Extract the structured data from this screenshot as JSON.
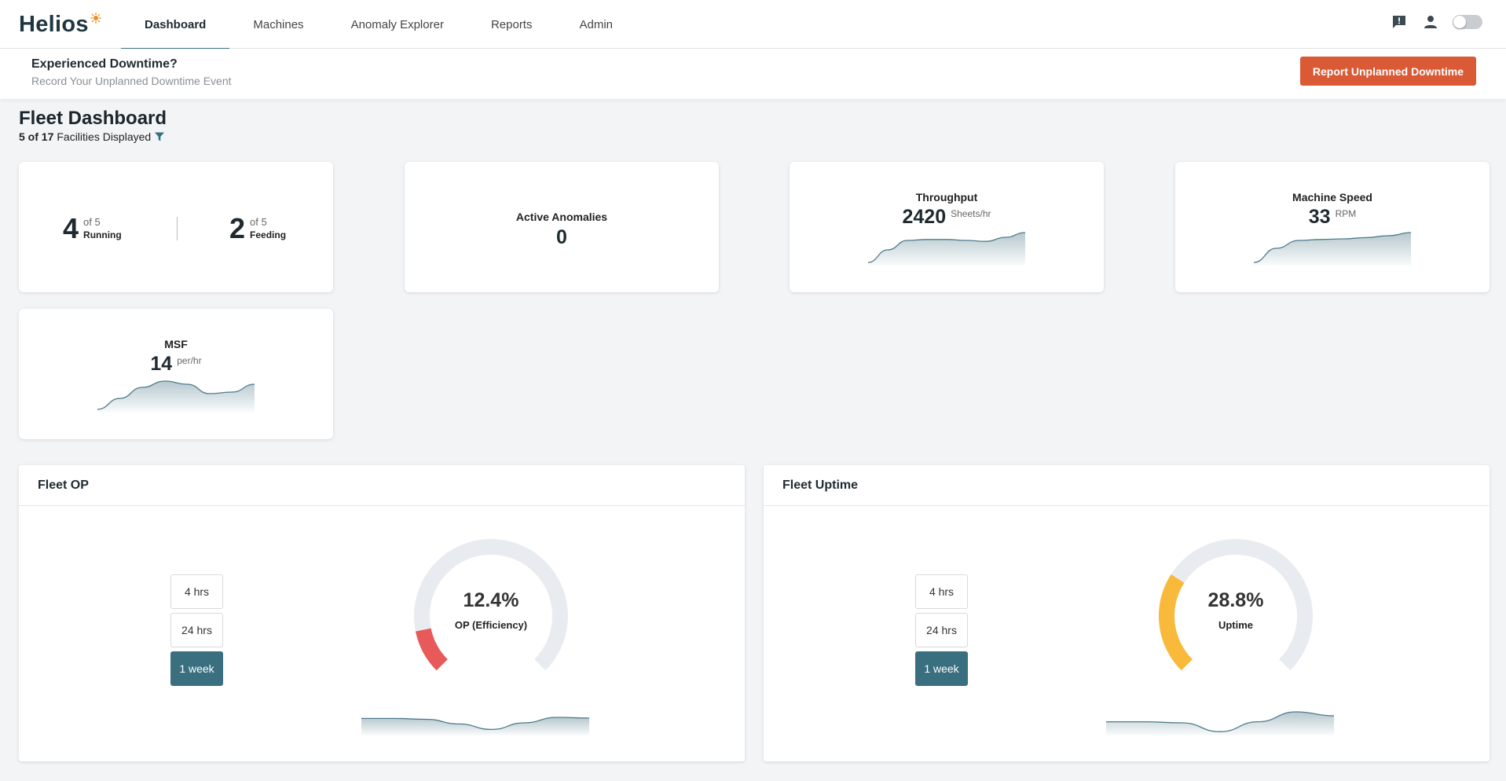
{
  "app": {
    "name": "Helios"
  },
  "nav": {
    "items": [
      {
        "label": "Dashboard"
      },
      {
        "label": "Machines"
      },
      {
        "label": "Anomaly Explorer"
      },
      {
        "label": "Reports"
      },
      {
        "label": "Admin"
      }
    ],
    "active_index": 0
  },
  "header_icons": [
    "feedback-icon",
    "user-icon",
    "theme-toggle"
  ],
  "banner": {
    "title": "Experienced Downtime?",
    "subtitle": "Record Your Unplanned Downtime Event",
    "button_label": "Report Unplanned Downtime"
  },
  "dashboard": {
    "title": "Fleet Dashboard",
    "facilities_count": "5 of 17",
    "facilities_text": "Facilities Displayed"
  },
  "status_card": {
    "running": {
      "value": "4",
      "of": "of 5",
      "label": "Running"
    },
    "feeding": {
      "value": "2",
      "of": "of 5",
      "label": "Feeding"
    }
  },
  "anomalies_card": {
    "label": "Active Anomalies",
    "value": "0"
  },
  "throughput_card": {
    "label": "Throughput",
    "value": "2420",
    "unit": "Sheets/hr",
    "spark": [
      0.05,
      0.45,
      0.75,
      0.78,
      0.78,
      0.75,
      0.72,
      0.85,
      1.0
    ]
  },
  "speed_card": {
    "label": "Machine Speed",
    "value": "33",
    "unit": "RPM",
    "spark": [
      0.05,
      0.5,
      0.75,
      0.78,
      0.8,
      0.84,
      0.9,
      1.0
    ]
  },
  "msf_card": {
    "label": "MSF",
    "value": "14",
    "unit": "per/hr",
    "spark": [
      0.05,
      0.4,
      0.75,
      0.95,
      0.85,
      0.55,
      0.6,
      0.85
    ]
  },
  "fleet_op": {
    "title": "Fleet OP",
    "ranges": [
      "4 hrs",
      "24 hrs",
      "1 week"
    ],
    "selected_range": 2,
    "gauge_value": "12.4%",
    "gauge_label": "OP (Efficiency)",
    "percent": 12.4,
    "color": "#e85a5a",
    "trend": [
      0.7,
      0.7,
      0.66,
      0.45,
      0.2,
      0.5,
      0.75,
      0.72
    ]
  },
  "fleet_uptime": {
    "title": "Fleet Uptime",
    "ranges": [
      "4 hrs",
      "24 hrs",
      "1 week"
    ],
    "selected_range": 2,
    "gauge_value": "28.8%",
    "gauge_label": "Uptime",
    "percent": 28.8,
    "color": "#f9b93a",
    "trend": [
      0.55,
      0.55,
      0.5,
      0.1,
      0.55,
      1.0,
      0.82
    ]
  },
  "colors": {
    "accent": "#3a6f7f",
    "cta": "#d95a35",
    "gauge_track": "#e8ecf0",
    "spark_line": "#4d7b8c"
  }
}
